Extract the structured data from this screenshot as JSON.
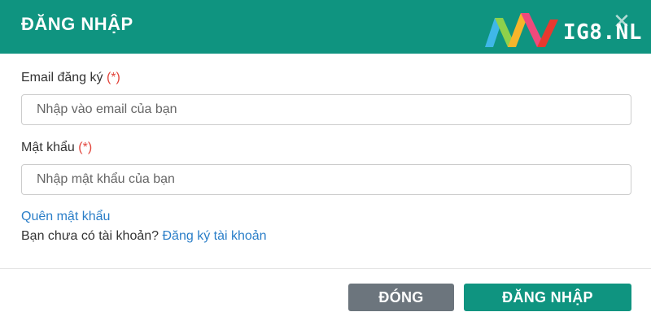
{
  "header": {
    "title": "ĐĂNG NHẬP",
    "close_icon": "close-icon",
    "brand_color": "#0f9480"
  },
  "logo": {
    "text": "IG8.NL",
    "icon": "ig8-logo-mark"
  },
  "form": {
    "email_label": "Email đăng ký",
    "email_required": "(*)",
    "email_placeholder": "Nhập vào email của bạn",
    "email_value": "",
    "password_label": "Mật khẩu",
    "password_required": "(*)",
    "password_placeholder": "Nhập mật khẩu của bạn",
    "password_value": ""
  },
  "links": {
    "forgot_password": "Quên mật khẩu",
    "no_account_text": "Bạn chưa có tài khoản?",
    "register": "Đăng ký tài khoản"
  },
  "footer": {
    "close_button": "ĐÓNG",
    "login_button": "ĐĂNG NHẬP",
    "close_button_color": "#6c757d",
    "login_button_color": "#0f9480"
  }
}
